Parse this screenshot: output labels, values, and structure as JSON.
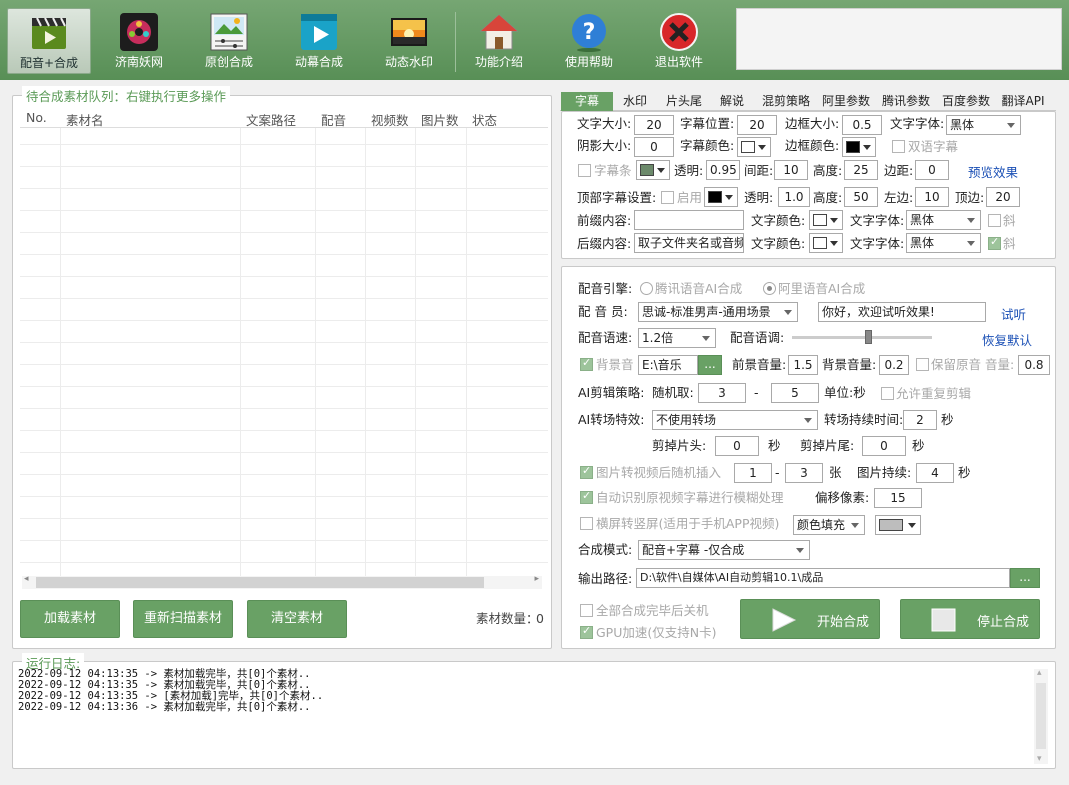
{
  "toolbar": {
    "items": [
      {
        "label": "配音+合成",
        "icon": "clapperboard-icon"
      },
      {
        "label": "济南妖网",
        "icon": "film-reel-icon"
      },
      {
        "label": "原创合成",
        "icon": "image-sliders-icon"
      },
      {
        "label": "动幕合成",
        "icon": "video-play-icon"
      },
      {
        "label": "动态水印",
        "icon": "sunset-photo-icon"
      },
      {
        "label": "功能介绍",
        "icon": "house-icon"
      },
      {
        "label": "使用帮助",
        "icon": "help-question-icon"
      },
      {
        "label": "退出软件",
        "icon": "exit-close-icon"
      }
    ]
  },
  "queue": {
    "title": "待合成素材队列：右键执行更多操作",
    "columns": [
      "No.",
      "素材名",
      "文案路径",
      "配音",
      "视频数",
      "图片数",
      "状态"
    ],
    "rows": [],
    "buttons": {
      "load": "加载素材",
      "rescan": "重新扫描素材",
      "clear": "清空素材"
    },
    "count_label": "素材数量：",
    "count": "0"
  },
  "tabs": [
    "字幕",
    "水印",
    "片头尾",
    "解说",
    "混剪策略",
    "阿里参数",
    "腾讯参数",
    "百度参数",
    "翻译API"
  ],
  "subtitle": {
    "font_size_label": "文字大小:",
    "font_size": "20",
    "position_label": "字幕位置:",
    "position": "20",
    "border_size_label": "边框大小:",
    "border_size": "0.5",
    "font_label": "文字字体:",
    "font": "黑体",
    "shadow_label": "阴影大小:",
    "shadow": "0",
    "color_label": "字幕颜色:",
    "border_color_label": "边框颜色:",
    "bilingual_label": "双语字幕",
    "bar_label": "字幕条",
    "alpha_label": "透明:",
    "alpha": "0.95",
    "spacing_label": "间距:",
    "spacing": "10",
    "height_label": "高度:",
    "height": "25",
    "margin_label": "边距:",
    "margin": "0",
    "preview_label": "预览效果",
    "top_label": "顶部字幕设置:",
    "top_enable_label": "启用",
    "top_alpha_label": "透明:",
    "top_alpha": "1.0",
    "top_height_label": "高度:",
    "top_height": "50",
    "left_label": "左边:",
    "left": "10",
    "top_margin_label": "顶边:",
    "top_margin": "20",
    "prefix_label": "前缀内容:",
    "prefix": "",
    "prefix_color_label": "文字颜色:",
    "prefix_font_label": "文字字体:",
    "prefix_font": "黑体",
    "italic_label": "斜",
    "suffix_label": "后缀内容:",
    "suffix": "取子文件夹名或音频",
    "suffix_color_label": "文字颜色:",
    "suffix_font_label": "文字字体:",
    "suffix_font": "黑体"
  },
  "voice": {
    "engine_label": "配音引擎:",
    "engine_tencent": "腾讯语音AI合成",
    "engine_ali": "阿里语音AI合成",
    "voicer_label": "配 音 员:",
    "voicer": "思诚-标准男声-通用场景",
    "test_text": "你好，欢迎试听效果!",
    "listen_label": "试听",
    "speed_label": "配音语速:",
    "speed": "1.2倍",
    "pitch_label": "配音语调:",
    "pitch_level": 0.55,
    "reset_label": "恢复默认",
    "bgm_label": "背景音",
    "bgm_path": "E:\\音乐",
    "browse_label": "...",
    "front_vol_label": "前景音量:",
    "front_vol": "1.5",
    "back_vol_label": "背景音量:",
    "back_vol": "0.2",
    "keep_label": "保留原音 音量:",
    "keep_vol": "0.8",
    "cut_label": "AI剪辑策略:",
    "random_label": "随机取:",
    "rand_from": "3",
    "dash": "-",
    "rand_to": "5",
    "unit_label": "单位:秒",
    "repeat_label": "允许重复剪辑",
    "transition_label": "AI转场特效:",
    "transition": "不使用转场",
    "trans_dur_label": "转场持续时间:",
    "trans_dur": "2",
    "sec": "秒",
    "head_cut_label": "剪掉片头:",
    "head_cut": "0",
    "tail_cut_label": "剪掉片尾:",
    "tail_cut": "0",
    "img_insert_label": "图片转视频后随机插入",
    "img_from": "1",
    "img_to": "3",
    "zhang": "张",
    "img_dur_label": "图片持续:",
    "img_dur": "4",
    "blur_label": "自动识别原视频字幕进行模糊处理",
    "offset_label": "偏移像素:",
    "offset": "15",
    "landscape_label": "横屏转竖屏(适用于手机APP视频)",
    "fill_mode": "颜色填充",
    "mode_label": "合成模式:",
    "mode": "配音+字幕 -仅合成",
    "output_label": "输出路径:",
    "output_path": "D:\\软件\\自媒体\\AI自动剪辑10.1\\成品",
    "shutdown_label": "全部合成完毕后关机",
    "gpu_label": "GPU加速(仅支持N卡)",
    "start_label": "开始合成",
    "stop_label": "停止合成"
  },
  "log": {
    "title": "运行日志:",
    "lines": [
      "2022-09-12 04:13:35 -> 素材加载完毕，共[0]个素材..",
      "2022-09-12 04:13:35 -> 素材加载完毕，共[0]个素材..",
      "2022-09-12 04:13:35 -> [素材加载]完毕，共[0]个素材..",
      "2022-09-12 04:13:36 -> 素材加载完毕，共[0]个素材.."
    ]
  },
  "colors": {
    "accent": "#69a165",
    "toolbar": "#6a9f67"
  }
}
